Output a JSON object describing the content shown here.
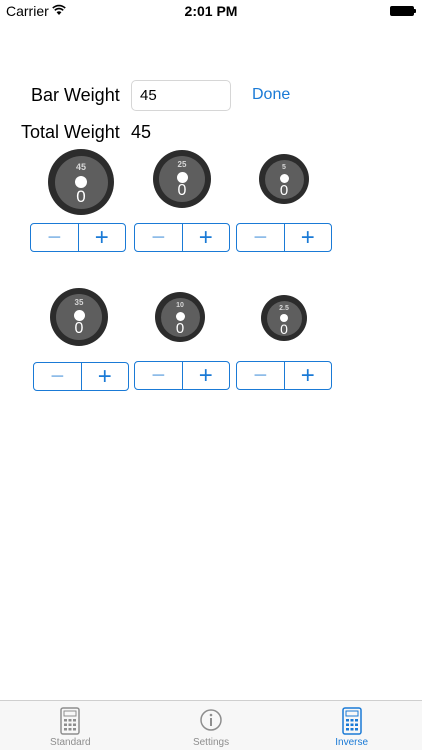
{
  "status_bar": {
    "carrier": "Carrier",
    "time": "2:01 PM"
  },
  "bar_weight": {
    "label": "Bar Weight",
    "value": "45",
    "done_label": "Done"
  },
  "total_weight": {
    "label": "Total Weight",
    "value": "45"
  },
  "plates": [
    {
      "weight": "45",
      "count": "0"
    },
    {
      "weight": "25",
      "count": "0"
    },
    {
      "weight": "5",
      "count": "0"
    },
    {
      "weight": "35",
      "count": "0"
    },
    {
      "weight": "10",
      "count": "0"
    },
    {
      "weight": "2.5",
      "count": "0"
    }
  ],
  "stepper": {
    "minus": "−",
    "plus": "+"
  },
  "tabs": [
    {
      "label": "Standard",
      "icon": "calculator-icon",
      "active": false
    },
    {
      "label": "Settings",
      "icon": "info-icon",
      "active": false
    },
    {
      "label": "Inverse",
      "icon": "calculator-icon",
      "active": true
    }
  ],
  "colors": {
    "accent": "#1a7ad6",
    "plate_outer": "#2c2c2c",
    "plate_inner": "#5e5e5e"
  }
}
